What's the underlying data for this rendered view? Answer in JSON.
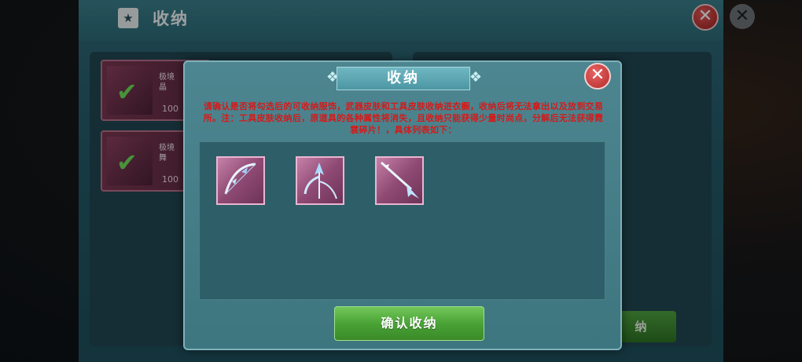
{
  "background_window": {
    "title": "收纳",
    "title_icon": "wardrobe-icon",
    "items": [
      {
        "name": "极境\n晶",
        "price": "100",
        "icon": "bow-weapon-icon"
      },
      {
        "name": "极境\n舞",
        "price": "100",
        "icon": "scythe-weapon-icon"
      }
    ],
    "right_button_label": "纳"
  },
  "dialog": {
    "title": "收纳",
    "close_icon": "close-icon",
    "message": "请确认是否将勾选后的可收纳服饰，武器皮肤和工具皮肤收纳进衣橱，收纳后将无法拿出以及放到交易所。注：工具皮肤收纳后，原道具的各种属性将消失，且收纳只能获得少量时尚点，分解后无法获得霓裳碎片！，具体列表如下：",
    "items": [
      {
        "icon": "crystal-bow-icon"
      },
      {
        "icon": "crystal-scythe-icon"
      },
      {
        "icon": "crystal-spear-icon"
      }
    ],
    "confirm_label": "确认收纳"
  },
  "colors": {
    "accent_red": "#d51a1a",
    "confirm_green": "#4aa336",
    "dialog_bg": "#4d8690"
  }
}
